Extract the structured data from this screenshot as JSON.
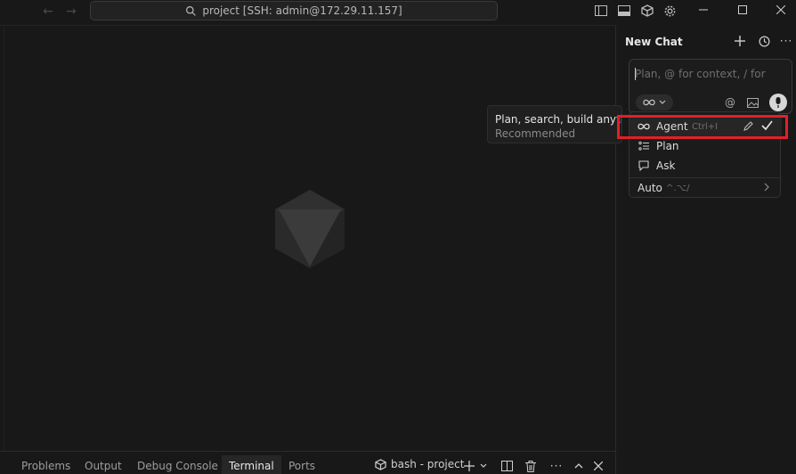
{
  "titlebar": {
    "back_icon": "arrow-left-icon",
    "forward_icon": "arrow-right-icon",
    "command_center": "project [SSH: admin@172.29.11.157]"
  },
  "chat": {
    "tab_label": "New Chat",
    "composer_placeholder": "Plan, @ for context, / for",
    "mode_pill_icon": "infinity-icon"
  },
  "tooltip": {
    "title": "Plan, search, build anything",
    "subtitle": "Recommended"
  },
  "mode_menu": {
    "items": [
      {
        "label": "Agent",
        "shortcut": "Ctrl+I",
        "icon": "infinity-icon",
        "selected": true
      },
      {
        "label": "Plan",
        "icon": "checklist-icon"
      },
      {
        "label": "Ask",
        "icon": "chat-bubble-icon"
      }
    ],
    "auto_label": "Auto",
    "auto_shortcut": "^.⌥/"
  },
  "panel": {
    "tabs": [
      "Problems",
      "Output",
      "Debug Console",
      "Terminal",
      "Ports"
    ],
    "active_tab": "Terminal",
    "terminal_name": "bash - project"
  },
  "colors": {
    "highlight": "#e0202a",
    "background": "#181818"
  }
}
